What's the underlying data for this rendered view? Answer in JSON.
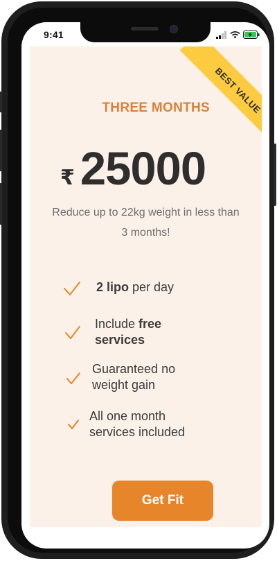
{
  "status_bar": {
    "time": "9:41"
  },
  "plan": {
    "title": "THREE MONTHS",
    "ribbon": "BEST VALUE",
    "currency": "₹",
    "price": "25000",
    "description": "Reduce up to 22kg weight in less than 3 months!"
  },
  "features": [
    {
      "bold": "2 lipo",
      "rest": " per day"
    },
    {
      "pre": "Include ",
      "bold": "free services"
    },
    {
      "text": "Guaranteed no weight gain"
    },
    {
      "text": "All one month services included"
    }
  ],
  "cta": {
    "label": "Get Fit"
  },
  "colors": {
    "accent": "#e7852b",
    "title": "#d9813a",
    "ribbon": "#fccb40",
    "card_bg": "#fcf1e8"
  }
}
